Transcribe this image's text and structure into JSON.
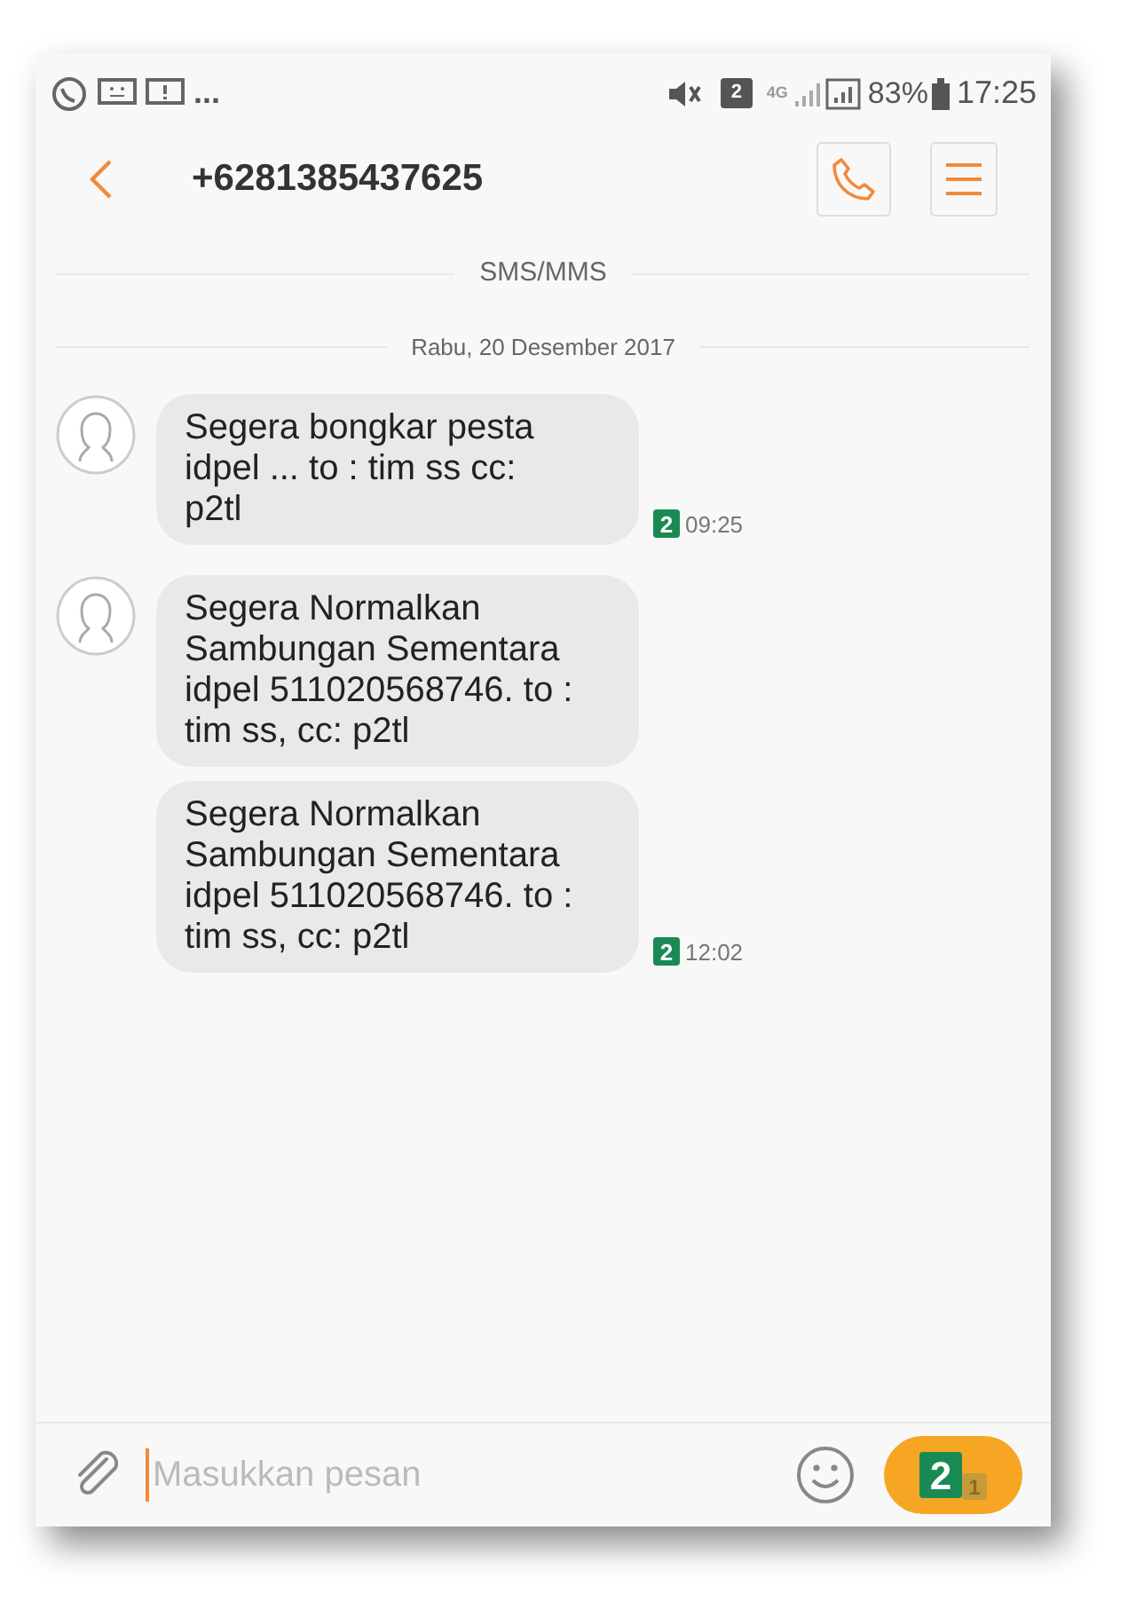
{
  "status_bar": {
    "more": "...",
    "network": "4G",
    "sim_badge": "2",
    "battery": "83%",
    "time": "17:25"
  },
  "header": {
    "title": "+6281385437625"
  },
  "channel_label": "SMS/MMS",
  "date_label": "Rabu, 20 Desember 2017",
  "messages": [
    {
      "text": "Segera bongkar pesta idpel ... to : tim ss cc: p2tl",
      "show_avatar": true,
      "sim": "2",
      "time": "09:25"
    },
    {
      "text": "Segera Normalkan Sambungan Sementara idpel 511020568746. to : tim ss, cc: p2tl",
      "show_avatar": true
    },
    {
      "text": "Segera Normalkan Sambungan Sementara idpel 511020568746. to : tim ss, cc: p2tl",
      "show_avatar": false,
      "sim": "2",
      "time": "12:02"
    }
  ],
  "composer": {
    "placeholder": "Masukkan pesan",
    "send_sims": [
      "2",
      "1"
    ]
  }
}
